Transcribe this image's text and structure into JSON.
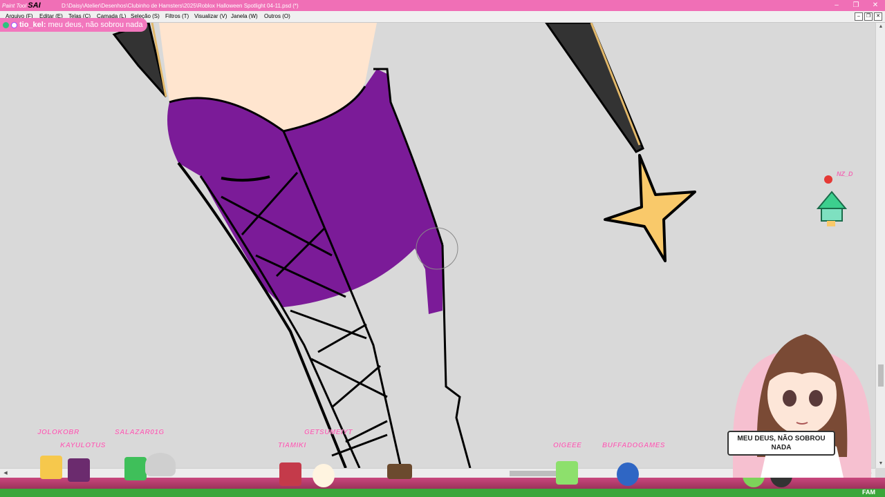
{
  "app": {
    "logo_small": "Paint Tool",
    "logo_big": "SAI",
    "document_path": "D:\\Daisy\\Atelier\\Desenhos\\Clubinho de Hamsters\\2025\\Roblox Halloween Spotlight 04-11.psd (*)"
  },
  "window_controls": {
    "minimize": "–",
    "restore": "❐",
    "close": "✕"
  },
  "menu": [
    "Arquivo (F)",
    "Editar (E)",
    "Telas (C)",
    "Camada (L)",
    "Seleção (S)",
    "Filtros (T)",
    "Visualizar (V)",
    "Janela (W)",
    "Outros (O)"
  ],
  "chat": {
    "user": "tio_kel:",
    "message": "meu deus, não sobrou nada"
  },
  "viewers": [
    "JOLOKOBR",
    "KAYULOTUS",
    "SALAZAR01G",
    "TIAMIKI",
    "GETSUMEIYT",
    "OIGEEE",
    "BUFFADOGAMES"
  ],
  "floating_tag": "NZ_D",
  "avatar_speech": "MEU DEUS, NÃO SOBROU NADA",
  "corner_label": "FAM",
  "colors": {
    "accent": "#f06fb6",
    "fabric": "#7b1b98",
    "star": "#f9c96a",
    "skin": "#ffe5cf"
  }
}
